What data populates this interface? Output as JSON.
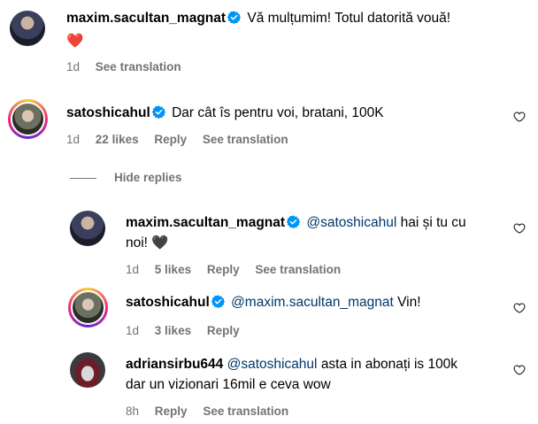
{
  "comments": [
    {
      "username": "maxim.sacultan_magnat",
      "text": "Vă mulțumim! Totul datorită vouă!",
      "emoji": "❤️",
      "age": "1d",
      "translation": "See translation"
    },
    {
      "username": "satoshicahul",
      "text": "Dar cât îs pentru voi, bratani, 100K",
      "age": "1d",
      "likes": "22 likes",
      "reply": "Reply",
      "translation": "See translation"
    }
  ],
  "hide_replies": "Hide replies",
  "replies": [
    {
      "username": "maxim.sacultan_magnat",
      "mention": "@satoshicahul",
      "text_line1": "hai și tu cu",
      "text_line2": "noi! 🖤",
      "age": "1d",
      "likes": "5 likes",
      "reply": "Reply",
      "translation": "See translation"
    },
    {
      "username": "satoshicahul",
      "mention": "@maxim.sacultan_magnat",
      "text": "Vin!",
      "age": "1d",
      "likes": "3 likes",
      "reply": "Reply"
    },
    {
      "username": "adriansirbu644",
      "mention": "@satoshicahul",
      "text_line1": "asta in abonați is 100k",
      "text_line2": "dar un vizionari 16mil e ceva wow",
      "age": "8h",
      "reply": "Reply",
      "translation": "See translation"
    }
  ],
  "colors": {
    "verified": "#0095f6",
    "mention": "#00376b",
    "meta": "#737373"
  }
}
